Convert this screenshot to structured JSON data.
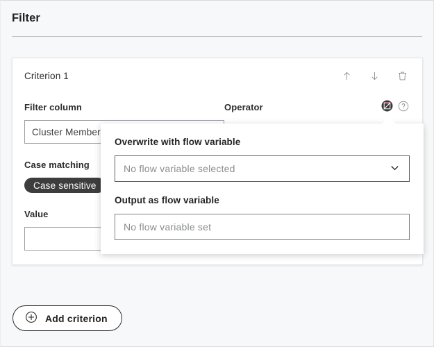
{
  "dialog": {
    "title": "Filter"
  },
  "criterion": {
    "label": "Criterion 1",
    "actions": [
      {
        "name": "move-up-button",
        "icon": "arrow-up-icon",
        "title": "Move up"
      },
      {
        "name": "move-down-button",
        "icon": "arrow-down-icon",
        "title": "Move down"
      },
      {
        "name": "delete-criterion-button",
        "icon": "trash-icon",
        "title": "Delete"
      }
    ],
    "filter_column": {
      "label": "Filter column",
      "value": "Cluster Membership"
    },
    "operator": {
      "label": "Operator"
    },
    "case_matching": {
      "label": "Case matching",
      "chip": "Case sensitive"
    },
    "value": {
      "label": "Value",
      "value": "",
      "placeholder": ""
    }
  },
  "footer": {
    "add_criterion_label": "Add criterion",
    "add_criterion_icon": "plus-circle-icon"
  },
  "flow_variable_popover": {
    "overwrite": {
      "label": "Overwrite with flow variable",
      "value": "No flow variable selected",
      "chevron_icon": "chevron-down-icon"
    },
    "output": {
      "label": "Output as flow variable",
      "value": "No flow variable set"
    }
  },
  "icons": {
    "flow_variable_icon": "flow-variable-icon",
    "help_icon": "help-circle-icon"
  },
  "colors": {
    "accent_red": "#e8185d",
    "chip_dark": "#3d3d3d",
    "page_background": "#f7f8f9",
    "card_background": "#ffffff"
  }
}
